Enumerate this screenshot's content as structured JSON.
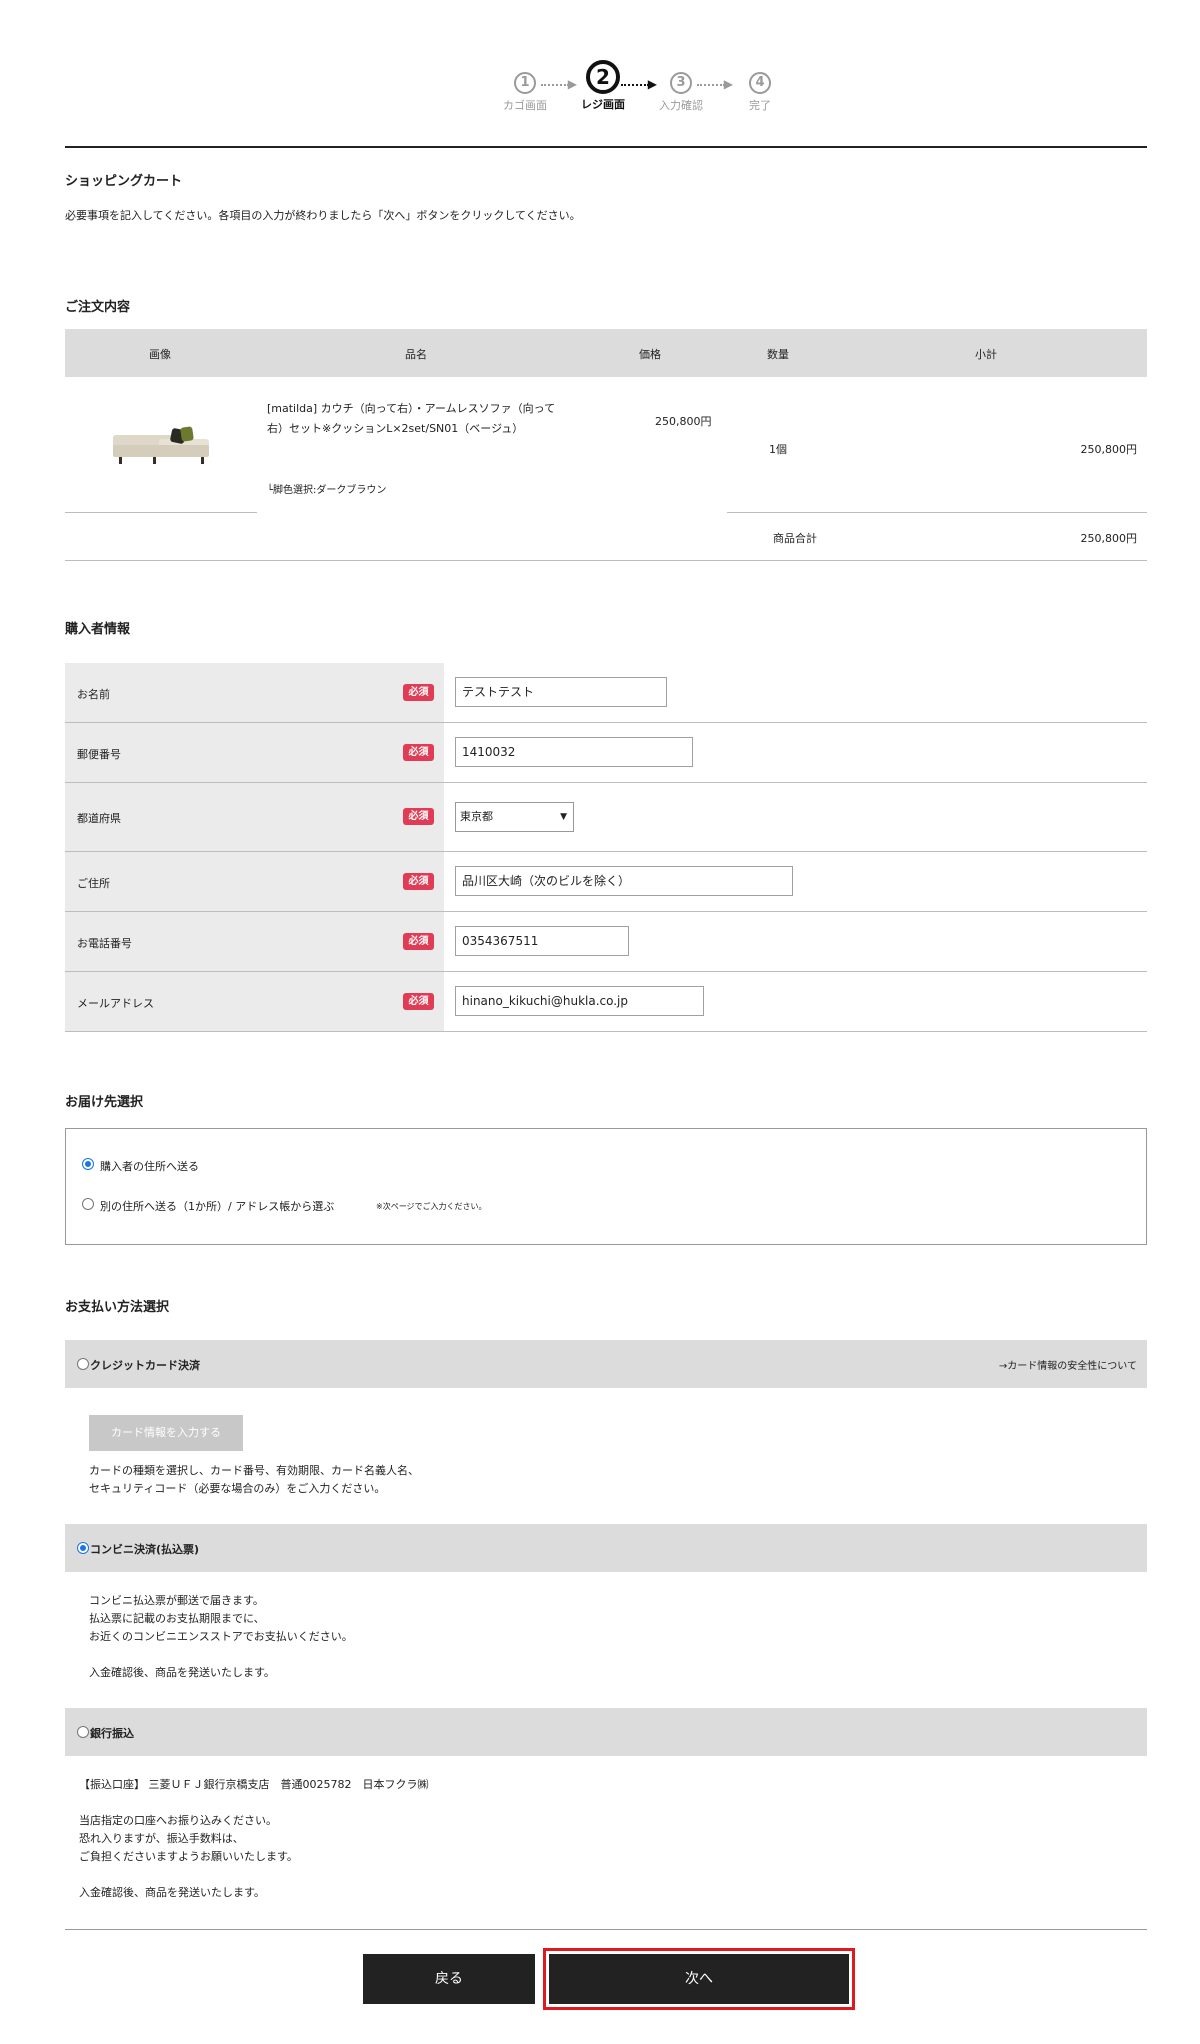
{
  "steps": [
    {
      "num": "1",
      "label": "カゴ画面"
    },
    {
      "num": "2",
      "label": "レジ画面"
    },
    {
      "num": "3",
      "label": "入力確認"
    },
    {
      "num": "4",
      "label": "完了"
    }
  ],
  "page": {
    "title": "ショッピングカート",
    "description": "必要事項を記入してください。各項目の入力が終わりましたら「次へ」ボタンをクリックしてください。"
  },
  "order": {
    "title": "ご注文内容",
    "headers": {
      "image": "画像",
      "name": "品名",
      "price": "価格",
      "qty": "数量",
      "subtotal": "小計"
    },
    "item": {
      "name": "[matilda] カウチ（向って右）・アームレスソファ（向って右）セット※クッションL×2set/SN01（ベージュ）",
      "option": "└脚色選択:ダークブラウン",
      "price": "250,800円",
      "qty": "1個",
      "subtotal": "250,800円"
    },
    "total_label": "商品合計",
    "total_value": "250,800円"
  },
  "buyer": {
    "title": "購入者情報",
    "required": "必須",
    "name_label": "お名前",
    "name_value": "テストテスト",
    "zip_label": "郵便番号",
    "zip_value": "1410032",
    "pref_label": "都道府県",
    "pref_value": "東京都",
    "address_label": "ご住所",
    "address_value": "品川区大崎（次のビルを除く）",
    "tel_label": "お電話番号",
    "tel_value": "0354367511",
    "email_label": "メールアドレス",
    "email_value": "hinano_kikuchi@hukla.co.jp"
  },
  "delivery": {
    "title": "お届け先選択",
    "option1": "購入者の住所へ送る",
    "option2": "別の住所へ送る（1か所）/ アドレス帳から選ぶ",
    "option2_note": "※次ページでご入力ください。"
  },
  "payment": {
    "title": "お支払い方法選択",
    "card_label": "クレジットカード決済",
    "card_security_link": "→カード情報の安全性について",
    "card_button": "カード情報を入力する",
    "card_text1": "カードの種類を選択し、カード番号、有効期限、カード名義人名、",
    "card_text2": "セキュリティコード（必要な場合のみ）をご入力ください。",
    "conv_label": "コンビニ決済(払込票)",
    "conv_text1": "コンビニ払込票が郵送で届きます。",
    "conv_text2": "払込票に記載のお支払期限までに、",
    "conv_text3": "お近くのコンビニエンスストアでお支払いください。",
    "conv_text4": "入金確認後、商品を発送いたします。",
    "bank_label": "銀行振込",
    "bank_text1": "【振込口座】 三菱ＵＦＪ銀行京橋支店　普通0025782　日本フクラ㈱",
    "bank_text2": "当店指定の口座へお振り込みください。",
    "bank_text3": "恐れ入りますが、振込手数料は、",
    "bank_text4": "ご負担くださいますようお願いいたします。",
    "bank_text5": "入金確認後、商品を発送いたします。"
  },
  "buttons": {
    "back": "戻る",
    "next": "次へ"
  }
}
